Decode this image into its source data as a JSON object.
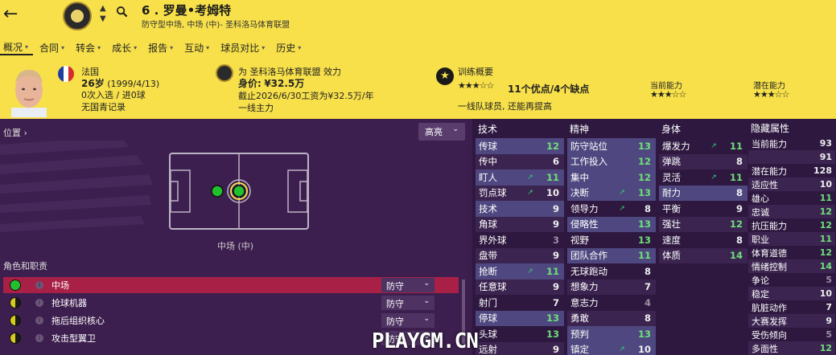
{
  "header": {
    "player_title": "6 . 罗曼•考姆特",
    "subtitle": "防守型中场, 中场 (中)- 圣科洛马体育联盟",
    "tabs": [
      {
        "label": "概况"
      },
      {
        "label": "合同"
      },
      {
        "label": "转会"
      },
      {
        "label": "成长"
      },
      {
        "label": "报告"
      },
      {
        "label": "互动"
      },
      {
        "label": "球员对比"
      },
      {
        "label": "历史"
      }
    ]
  },
  "bio": {
    "nationality": "法国",
    "age": "26岁",
    "dob": "(1999/4/13)",
    "caps": "0次入选 / 进0球",
    "youth": "无国青记录"
  },
  "club": {
    "club_line": "为 圣科洛马体育联盟 效力",
    "value_label": "身价:",
    "value": "¥32.5万",
    "contract": "截止2026/6/30工资为¥32.5万/年",
    "squad_status": "一线主力"
  },
  "training": {
    "title": "训练概要",
    "strengths": "11个优点",
    "weaknesses": "/4个缺点",
    "note": "一线队球员, 还能再提高",
    "current_ability_label": "当前能力",
    "potential_ability_label": "潜在能力",
    "star_rating": 2.5,
    "current_stars": 3,
    "potential_stars": 3
  },
  "position": {
    "label": "位置 ›",
    "highlight": "高亮",
    "position_name": "中场 (中)"
  },
  "roles": {
    "title": "角色和职责",
    "items": [
      {
        "name": "中场",
        "duty": "防守",
        "color": "#21c12e"
      },
      {
        "name": "抢球机器",
        "duty": "防守",
        "color": "#d6cc1f"
      },
      {
        "name": "拖后组织核心",
        "duty": "防守",
        "color": "#d6cc1f"
      },
      {
        "name": "攻击型翼卫",
        "duty": "防守",
        "color": "#d6cc1f"
      }
    ]
  },
  "technical": {
    "title": "技术",
    "items": [
      {
        "name": "传球",
        "value": "12",
        "hl": true
      },
      {
        "name": "传中",
        "value": "6"
      },
      {
        "name": "盯人",
        "value": "11",
        "hl": true,
        "up": true
      },
      {
        "name": "罚点球",
        "value": "10",
        "up": true
      },
      {
        "name": "技术",
        "value": "9",
        "hl": true
      },
      {
        "name": "角球",
        "value": "9"
      },
      {
        "name": "界外球",
        "value": "3"
      },
      {
        "name": "盘带",
        "value": "9"
      },
      {
        "name": "抢断",
        "value": "11",
        "hl": true,
        "up": true
      },
      {
        "name": "任意球",
        "value": "9"
      },
      {
        "name": "射门",
        "value": "7"
      },
      {
        "name": "停球",
        "value": "13",
        "hl": true
      },
      {
        "name": "头球",
        "value": "13"
      },
      {
        "name": "远射",
        "value": "9"
      }
    ]
  },
  "mental": {
    "title": "精神",
    "items": [
      {
        "name": "防守站位",
        "value": "13",
        "hl": true
      },
      {
        "name": "工作投入",
        "value": "12",
        "hl": true
      },
      {
        "name": "集中",
        "value": "12",
        "hl": true
      },
      {
        "name": "决断",
        "value": "13",
        "hl": true,
        "up": true
      },
      {
        "name": "领导力",
        "value": "8",
        "up": true
      },
      {
        "name": "侵略性",
        "value": "13",
        "hl": true
      },
      {
        "name": "视野",
        "value": "13"
      },
      {
        "name": "团队合作",
        "value": "11",
        "hl": true
      },
      {
        "name": "无球跑动",
        "value": "8"
      },
      {
        "name": "想象力",
        "value": "7"
      },
      {
        "name": "意志力",
        "value": "4"
      },
      {
        "name": "勇敢",
        "value": "8"
      },
      {
        "name": "预判",
        "value": "13",
        "hl": true
      },
      {
        "name": "镇定",
        "value": "10",
        "hl": true,
        "up": true
      }
    ]
  },
  "physical": {
    "title": "身体",
    "items": [
      {
        "name": "爆发力",
        "value": "11",
        "up": true
      },
      {
        "name": "弹跳",
        "value": "8"
      },
      {
        "name": "灵活",
        "value": "11",
        "up": true
      },
      {
        "name": "耐力",
        "value": "8",
        "hl": true
      },
      {
        "name": "平衡",
        "value": "9"
      },
      {
        "name": "强壮",
        "value": "12"
      },
      {
        "name": "速度",
        "value": "8"
      },
      {
        "name": "体质",
        "value": "14"
      }
    ]
  },
  "hidden": {
    "title": "隐藏属性",
    "items": [
      {
        "name": "当前能力",
        "value": "93"
      },
      {
        "name": "",
        "value": "91"
      },
      {
        "name": "潜在能力",
        "value": "128"
      },
      {
        "name": "适应性",
        "value": "10"
      },
      {
        "name": "雄心",
        "value": "11"
      },
      {
        "name": "忠诚",
        "value": "12"
      },
      {
        "name": "抗压能力",
        "value": "12"
      },
      {
        "name": "职业",
        "value": "11"
      },
      {
        "name": "体育道德",
        "value": "12"
      },
      {
        "name": "情绪控制",
        "value": "14"
      },
      {
        "name": "争论",
        "value": "5"
      },
      {
        "name": "稳定",
        "value": "10"
      },
      {
        "name": "肮脏动作",
        "value": "7"
      },
      {
        "name": "大赛发挥",
        "value": "9"
      },
      {
        "name": "受伤倾向",
        "value": "5"
      },
      {
        "name": "多面性",
        "value": "12"
      }
    ]
  },
  "watermark": "PLAYGM.CN"
}
